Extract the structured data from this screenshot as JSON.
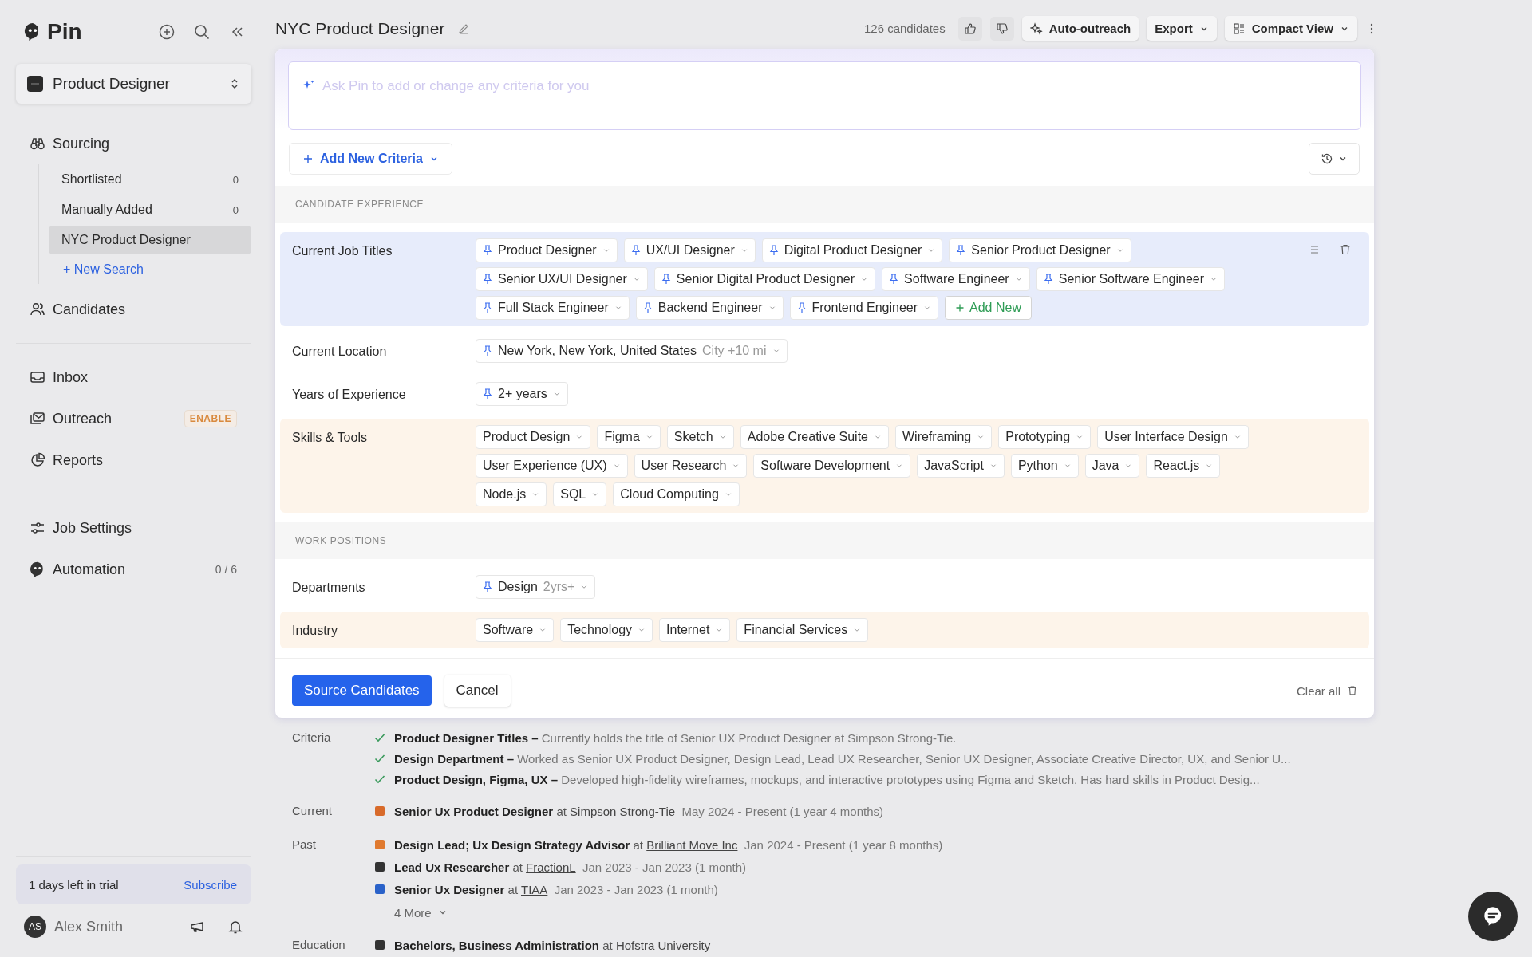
{
  "app": {
    "name": "Pin"
  },
  "workspace": {
    "name": "Product Designer"
  },
  "sidebar": {
    "groups": [
      {
        "items": [
          {
            "label": "Sourcing",
            "children": [
              {
                "label": "Shortlisted",
                "count": "0",
                "selected": false
              },
              {
                "label": "Manually Added",
                "count": "0",
                "selected": false
              },
              {
                "label": "NYC Product Designer",
                "selected": true
              }
            ],
            "new_search": "+ New Search"
          },
          {
            "label": "Candidates"
          }
        ]
      },
      {
        "items": [
          {
            "label": "Inbox"
          },
          {
            "label": "Outreach",
            "badge": "ENABLE"
          },
          {
            "label": "Reports"
          }
        ]
      },
      {
        "items": [
          {
            "label": "Job Settings"
          },
          {
            "label": "Automation",
            "count": "0 / 6"
          }
        ]
      }
    ],
    "trial": {
      "text": "1 days left in trial",
      "action": "Subscribe"
    },
    "user": {
      "initials": "AS",
      "name": "Alex Smith"
    }
  },
  "header": {
    "title": "NYC Product Designer",
    "count": "126 candidates",
    "buttons": [
      {
        "label": "Auto-outreach",
        "kind": "sparkle"
      },
      {
        "label": "Export",
        "kind": "caret"
      },
      {
        "label": "Compact View",
        "kind": "view"
      }
    ]
  },
  "criteria_panel": {
    "prompt": {
      "placeholder": "Ask Pin to add or change any criteria for you"
    },
    "add_criteria": "Add New Criteria",
    "sections": [
      {
        "heading": "CANDIDATE EXPERIENCE",
        "rows": [
          {
            "label": "Current Job Titles",
            "color": "#e7ecfb",
            "actions": true,
            "add_new": "Add New",
            "chips": [
              {
                "label": "Product Designer",
                "pinned": true
              },
              {
                "label": "UX/UI Designer",
                "pinned": true
              },
              {
                "label": "Digital Product Designer",
                "pinned": true
              },
              {
                "label": "Senior Product Designer",
                "pinned": true
              },
              {
                "label": "Senior UX/UI Designer",
                "pinned": true
              },
              {
                "label": "Senior Digital Product Designer",
                "pinned": true
              },
              {
                "label": "Software Engineer",
                "pinned": true
              },
              {
                "label": "Senior Software Engineer",
                "pinned": true
              },
              {
                "label": "Full Stack Engineer",
                "pinned": true
              },
              {
                "label": "Backend Engineer",
                "pinned": true
              },
              {
                "label": "Frontend Engineer",
                "pinned": true
              }
            ]
          },
          {
            "label": "Current Location",
            "chips": [
              {
                "label": "New York, New York, United States",
                "pinned": true,
                "suffix": "City +10 mi"
              }
            ]
          },
          {
            "label": "Years of Experience",
            "chips": [
              {
                "label": "2+ years",
                "pinned": true
              }
            ]
          },
          {
            "label": "Skills & Tools",
            "color": "#fdf4ea",
            "chips": [
              {
                "label": "Product Design",
                "pinned": false
              },
              {
                "label": "Figma",
                "pinned": false
              },
              {
                "label": "Sketch",
                "pinned": false
              },
              {
                "label": "Adobe Creative Suite",
                "pinned": false
              },
              {
                "label": "Wireframing",
                "pinned": false
              },
              {
                "label": "Prototyping",
                "pinned": false
              },
              {
                "label": "User Interface Design",
                "pinned": false
              },
              {
                "label": "User Experience (UX)",
                "pinned": false
              },
              {
                "label": "User Research",
                "pinned": false
              },
              {
                "label": "Software Development",
                "pinned": false
              },
              {
                "label": "JavaScript",
                "pinned": false
              },
              {
                "label": "Python",
                "pinned": false
              },
              {
                "label": "Java",
                "pinned": false
              },
              {
                "label": "React.js",
                "pinned": false
              },
              {
                "label": "Node.js",
                "pinned": false
              },
              {
                "label": "SQL",
                "pinned": false
              },
              {
                "label": "Cloud Computing",
                "pinned": false
              }
            ]
          }
        ]
      },
      {
        "heading": "WORK POSITIONS",
        "rows": [
          {
            "label": "Departments",
            "chips": [
              {
                "label": "Design",
                "pinned": true,
                "suffix": "2yrs+"
              }
            ]
          },
          {
            "label": "Industry",
            "color": "#fdf4ea",
            "chips": [
              {
                "label": "Software",
                "pinned": false
              },
              {
                "label": "Technology",
                "pinned": false
              },
              {
                "label": "Internet",
                "pinned": false
              },
              {
                "label": "Financial Services",
                "pinned": false
              }
            ]
          }
        ]
      }
    ],
    "primary": "Source Candidates",
    "cancel": "Cancel",
    "clear": "Clear all"
  },
  "candidate": {
    "criteria": {
      "label": "Criteria",
      "items": [
        {
          "title": "Product Designer Titles –",
          "text": "Currently holds the title of Senior UX Product Designer at Simpson Strong-Tie."
        },
        {
          "title": "Design Department –",
          "text": "Worked as Senior UX Product Designer, Design Lead, Lead UX Researcher, Senior UX Designer, Associate Creative Director, UX, and Senior U..."
        },
        {
          "title": "Product Design, Figma, UX –",
          "text": "Developed high-fidelity wireframes, mockups, and interactive prototypes using Figma and Sketch. Has hard skills in Product Desig..."
        }
      ]
    },
    "current": {
      "label": "Current",
      "items": [
        {
          "role": "Senior Ux Product Designer",
          "at": "at",
          "company": "Simpson Strong-Tie",
          "dates": "May 2024 - Present (1 year 4 months)"
        }
      ]
    },
    "past": {
      "label": "Past",
      "items": [
        {
          "role": "Design Lead; Ux Design Strategy Advisor",
          "at": "at",
          "company": "Brilliant Move Inc",
          "dates": "Jan 2024 - Present (1 year 8 months)"
        },
        {
          "role": "Lead Ux Researcher",
          "at": "at",
          "company": "FractionL",
          "dates": "Jan 2023 - Jan 2023 (1 month)"
        },
        {
          "role": "Senior Ux Designer",
          "at": "at",
          "company": "TIAA",
          "dates": "Jan 2023 - Jan 2023 (1 month)"
        }
      ],
      "more": "4 More"
    },
    "education": {
      "label": "Education",
      "items": [
        {
          "role": "Bachelors, Business Administration",
          "at": "at",
          "company": "Hofstra University"
        }
      ]
    }
  }
}
